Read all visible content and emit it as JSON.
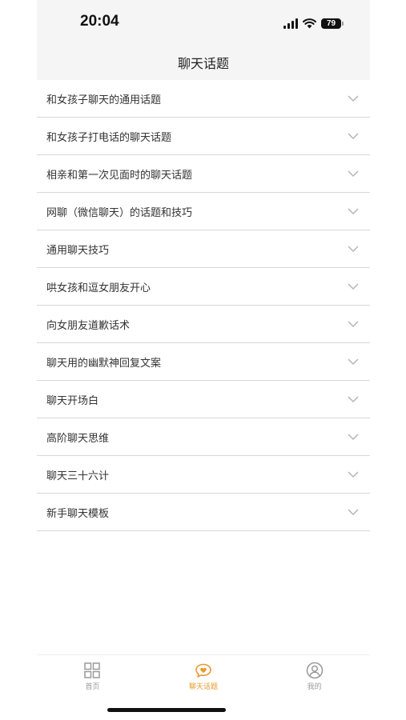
{
  "status_bar": {
    "time": "20:04",
    "battery": "79"
  },
  "header": {
    "title": "聊天话题"
  },
  "topics": [
    {
      "label": "和女孩子聊天的通用话题"
    },
    {
      "label": "和女孩子打电话的聊天话题"
    },
    {
      "label": "相亲和第一次见面时的聊天话题"
    },
    {
      "label": "网聊（微信聊天）的话题和技巧"
    },
    {
      "label": "通用聊天技巧"
    },
    {
      "label": "哄女孩和逗女朋友开心"
    },
    {
      "label": "向女朋友道歉话术"
    },
    {
      "label": "聊天用的幽默神回复文案"
    },
    {
      "label": "聊天开场白"
    },
    {
      "label": "高阶聊天思维"
    },
    {
      "label": "聊天三十六计"
    },
    {
      "label": "新手聊天模板"
    }
  ],
  "tab_bar": {
    "tabs": [
      {
        "label": "首页",
        "icon": "grid-icon",
        "active": false
      },
      {
        "label": "聊天话题",
        "icon": "chat-heart-icon",
        "active": true
      },
      {
        "label": "我的",
        "icon": "user-icon",
        "active": false
      }
    ]
  },
  "colors": {
    "accent": "#e89a2f",
    "inactive": "#9a9a9a",
    "header_bg": "#f5f5f5",
    "divider": "#d8d8d8"
  }
}
